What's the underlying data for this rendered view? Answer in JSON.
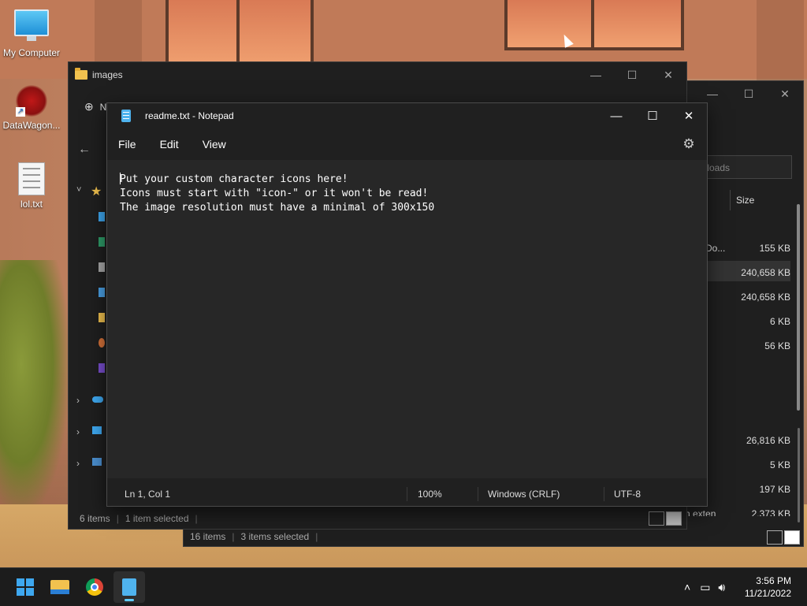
{
  "desktop": {
    "icons": [
      {
        "label": "My Computer"
      },
      {
        "label": "DataWagon..."
      },
      {
        "label": "lol.txt"
      }
    ]
  },
  "explorer_back": {
    "search_placeholder": "wnloads",
    "column_size": "Size",
    "partial_name": "Do...",
    "sizes": [
      "155 KB",
      "240,658 KB",
      "240,658 KB",
      "6 KB",
      "56 KB",
      "26,816 KB",
      "5 KB",
      "197 KB",
      "2,373 KB"
    ],
    "partial_bottom": "n exten",
    "status": {
      "items": "16 items",
      "selected": "3 items selected"
    }
  },
  "explorer_front": {
    "title": "images",
    "new_label": "N",
    "status": {
      "items": "6 items",
      "selected": "1 item selected"
    }
  },
  "notepad": {
    "title": "readme.txt - Notepad",
    "menu": {
      "file": "File",
      "edit": "Edit",
      "view": "View"
    },
    "content": "Put your custom character icons here!\nIcons must start with \"icon-\" or it won't be read!\nThe image resolution must have a minimal of 300x150",
    "status": {
      "position": "Ln 1, Col 1",
      "zoom": "100%",
      "line_ending": "Windows (CRLF)",
      "encoding": "UTF-8"
    }
  },
  "taskbar": {
    "time": "3:56 PM",
    "date": "11/21/2022"
  }
}
